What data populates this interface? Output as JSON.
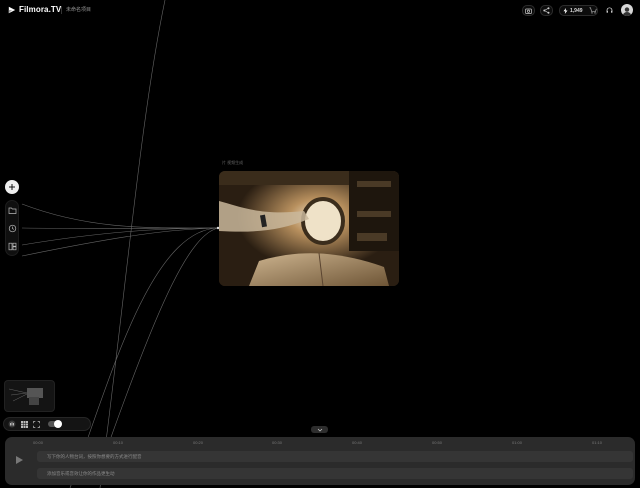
{
  "app": {
    "logo_text": "Filmora.TV",
    "project_name": "未命名项目"
  },
  "toolbar": {
    "credits": "1,949",
    "icons": [
      "screenshot-icon",
      "share-icon",
      "bolt-icon",
      "cart-icon",
      "headset-icon",
      "avatar"
    ]
  },
  "rail": {
    "items": [
      "add-icon",
      "folder-icon",
      "history-icon",
      "layers-icon"
    ]
  },
  "canvas": {
    "node_label": "片 视频生成"
  },
  "timeline": {
    "ticks": [
      "00:00",
      "00:10",
      "00:20",
      "00:30",
      "00:40",
      "00:50",
      "01:00",
      "01:10"
    ],
    "tracks": [
      "写下你的人物台词，按照你想要的方式进行配音",
      "添加音乐或音效让你的作品更生动"
    ]
  },
  "colors": {
    "background": "#000000",
    "panel": "#2b2b2b",
    "accent": "#ffffff"
  }
}
